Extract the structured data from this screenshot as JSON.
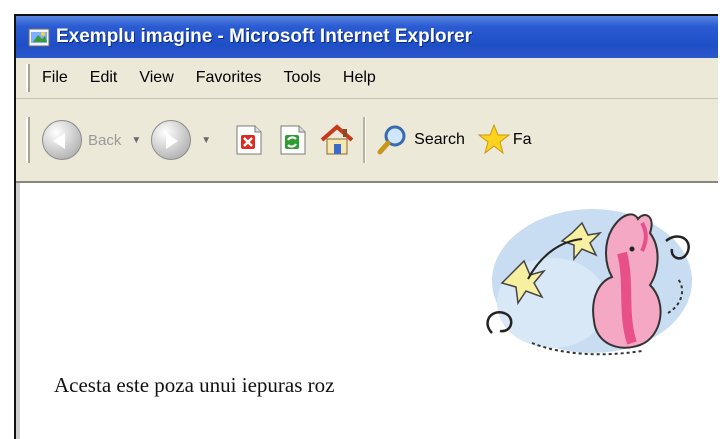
{
  "window": {
    "title": "Exemplu imagine - Microsoft Internet Explorer"
  },
  "menu": {
    "items": [
      "File",
      "Edit",
      "View",
      "Favorites",
      "Tools",
      "Help"
    ]
  },
  "toolbar": {
    "back_label": "Back",
    "search_label": "Search",
    "favorites_label": "Fa"
  },
  "content": {
    "caption": "Acesta este poza unui iepuras roz"
  },
  "colors": {
    "titlebar": "#2a5bd3",
    "chrome": "#ece9d8",
    "bunny_pink": "#e8508a"
  }
}
